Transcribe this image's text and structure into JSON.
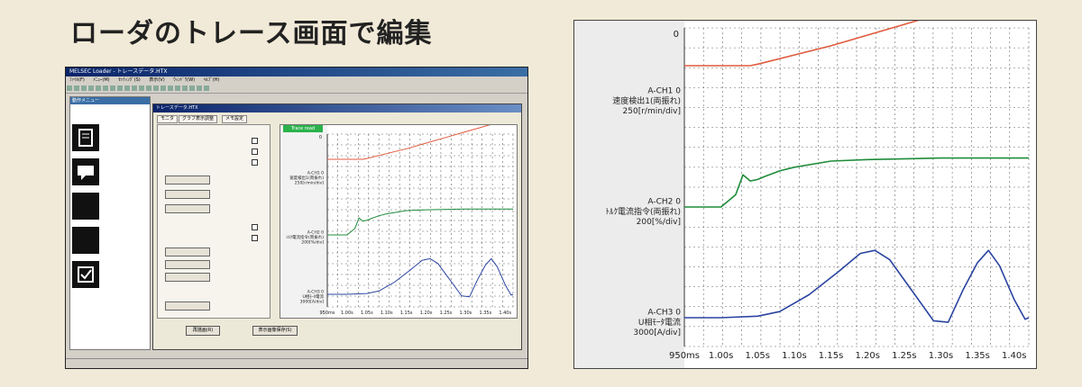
{
  "heading": "ローダのトレース画面で編集",
  "screenshot": {
    "title": "MELSEC Loader - トレースデータ.HTX",
    "menu": [
      "ﾌｧｲﾙ(F)",
      "ﾒﾆｭｰ(M)",
      "ｾｯﾃｨﾝｸﾞ(S)",
      "表示(V)",
      "ｳｨﾝﾄﾞｳ(W)",
      "ﾍﾙﾌﾟ(H)"
    ],
    "nav_title": "動作メニュー",
    "dialog_title": "トレースデータ.HTX",
    "tabs": [
      "モニタ",
      "グラフ表示調整",
      "メモ設定"
    ],
    "mini_green_label": "Trace read",
    "buttons": [
      "再描画(R)",
      "表示画像保存(S)"
    ]
  },
  "chart_data": {
    "type": "line",
    "x_ticks": [
      "950ms",
      "1.00s",
      "1.05s",
      "1.10s",
      "1.15s",
      "1.20s",
      "1.25s",
      "1.30s",
      "1.35s",
      "1.40s"
    ],
    "xlim": [
      0.95,
      1.42
    ],
    "y_top_label": "0",
    "series": [
      {
        "name": "A-CH1 0",
        "label_lines": [
          "A-CH1 0",
          "速度検出1(両振れ)",
          "250[r/min/div]"
        ],
        "color": "#e05a3c",
        "points": [
          [
            0.95,
            1.0
          ],
          [
            1.04,
            1.0
          ],
          [
            1.05,
            1.05
          ],
          [
            1.1,
            1.35
          ],
          [
            1.15,
            1.65
          ],
          [
            1.2,
            2.0
          ],
          [
            1.25,
            2.35
          ],
          [
            1.3,
            2.7
          ],
          [
            1.35,
            3.05
          ],
          [
            1.4,
            3.4
          ],
          [
            1.42,
            3.55
          ]
        ]
      },
      {
        "name": "A-CH2 0",
        "label_lines": [
          "A-CH2 0",
          "ﾄﾙｸ電流指令(両振れ)",
          "200[%/div]"
        ],
        "color": "#1e8c3a",
        "points": [
          [
            0.95,
            0.0
          ],
          [
            1.0,
            0.0
          ],
          [
            1.02,
            0.4
          ],
          [
            1.03,
            1.05
          ],
          [
            1.04,
            0.85
          ],
          [
            1.05,
            0.9
          ],
          [
            1.06,
            1.0
          ],
          [
            1.08,
            1.18
          ],
          [
            1.1,
            1.3
          ],
          [
            1.15,
            1.5
          ],
          [
            1.2,
            1.55
          ],
          [
            1.3,
            1.6
          ],
          [
            1.42,
            1.6
          ]
        ]
      },
      {
        "name": "A-CH3 0",
        "label_lines": [
          "A-CH3 0",
          "U相ﾓｰﾀ電流",
          "3000[A/div]"
        ],
        "color": "#2a44a0",
        "points": [
          [
            0.95,
            0.0
          ],
          [
            1.0,
            0.0
          ],
          [
            1.05,
            0.05
          ],
          [
            1.08,
            0.2
          ],
          [
            1.12,
            0.75
          ],
          [
            1.16,
            1.5
          ],
          [
            1.19,
            2.1
          ],
          [
            1.21,
            2.2
          ],
          [
            1.23,
            1.9
          ],
          [
            1.26,
            0.9
          ],
          [
            1.29,
            -0.1
          ],
          [
            1.31,
            -0.15
          ],
          [
            1.33,
            0.9
          ],
          [
            1.35,
            1.8
          ],
          [
            1.365,
            2.2
          ],
          [
            1.38,
            1.7
          ],
          [
            1.4,
            0.6
          ],
          [
            1.415,
            -0.05
          ],
          [
            1.42,
            0.0
          ]
        ]
      }
    ]
  }
}
